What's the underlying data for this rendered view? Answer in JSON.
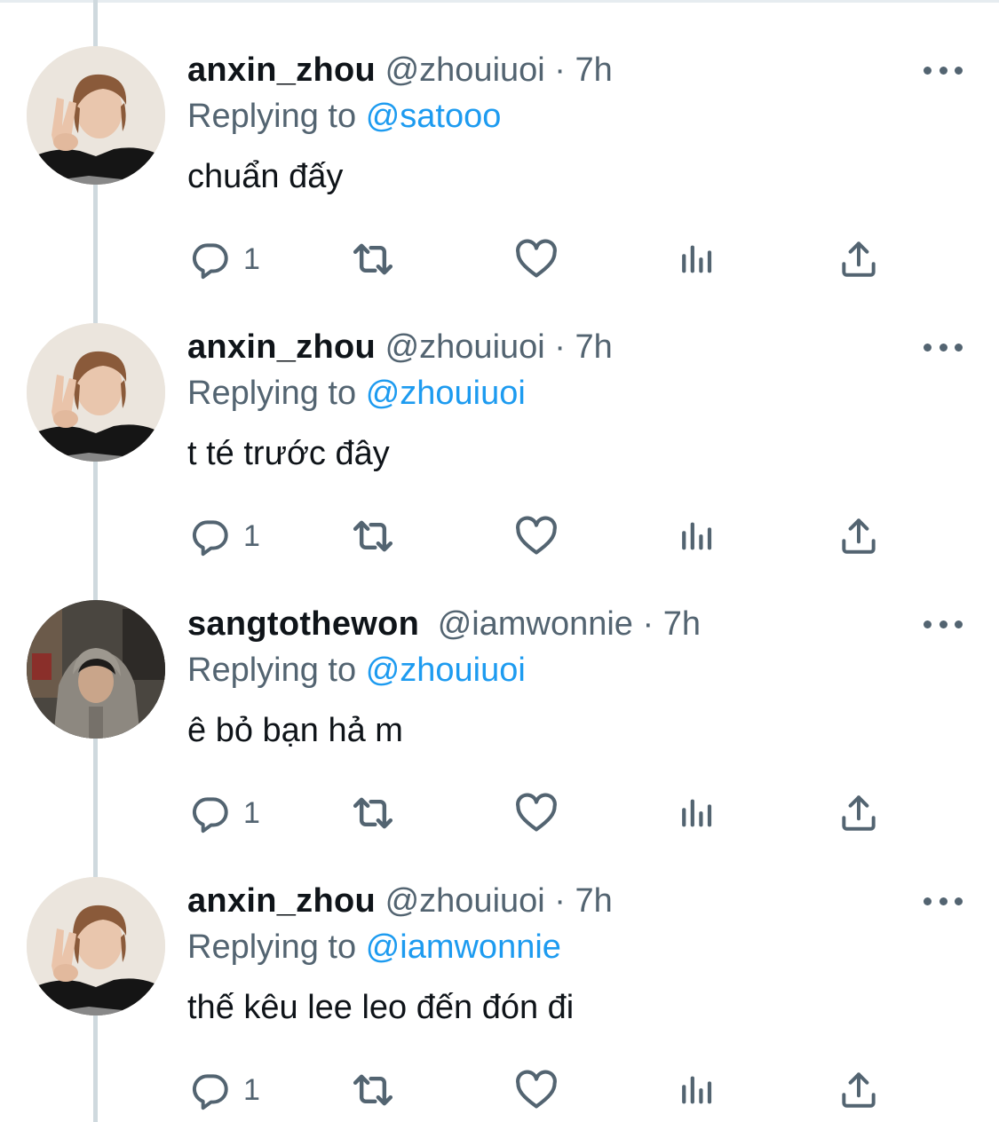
{
  "colors": {
    "text_primary": "#0f1419",
    "text_secondary": "#536471",
    "link": "#1d9bf0",
    "thread_line": "#cfd9de"
  },
  "tweets": [
    {
      "display_name": "anxin_zhou",
      "handle": "@zhouiuoi",
      "separator": "·",
      "time": "7h",
      "replying_prefix": "Replying to",
      "replying_to": "@satooo",
      "text": "chuẩn đấy",
      "reply_count": "1",
      "avatar": "anxin"
    },
    {
      "display_name": "anxin_zhou",
      "handle": "@zhouiuoi",
      "separator": "·",
      "time": "7h",
      "replying_prefix": "Replying to",
      "replying_to": "@zhouiuoi",
      "text": "t té trước đây",
      "reply_count": "1",
      "avatar": "anxin"
    },
    {
      "display_name": "sangtothewon",
      "handle": "@iamwonnie",
      "separator": "·",
      "time": "7h",
      "replying_prefix": "Replying to",
      "replying_to": "@zhouiuoi",
      "text": "ê bỏ bạn hả m",
      "reply_count": "1",
      "avatar": "sang"
    },
    {
      "display_name": "anxin_zhou",
      "handle": "@zhouiuoi",
      "separator": "·",
      "time": "7h",
      "replying_prefix": "Replying to",
      "replying_to": "@iamwonnie",
      "text": "thế kêu lee leo đến đón đi",
      "reply_count": "1",
      "avatar": "anxin"
    }
  ],
  "icons": {
    "reply": "reply-icon",
    "retweet": "retweet-icon",
    "like": "heart-icon",
    "views": "analytics-icon",
    "share": "share-icon",
    "more": "more-dots-icon"
  }
}
